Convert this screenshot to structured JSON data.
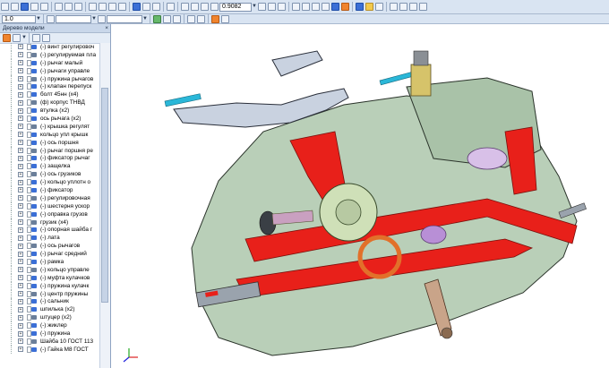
{
  "toolbar": {
    "zoom_value": "0.9082",
    "step_value": "1.0"
  },
  "panel": {
    "title": "Дерево модели",
    "close": "×"
  },
  "tree": [
    "(-) винт регулировоч",
    "(-) регулируемая пла",
    "(-) рычаг малый",
    "(-) рычаги управле",
    "(-) пружина рычагов",
    "(-) клапан перепуск",
    "болт 45нн (x4)",
    "(ф) корпус ТНВД",
    "втулка (x2)",
    "ось рычага (x2)",
    "(-) крышка регулят",
    "кольцо упл крышк",
    "(-) ось поршня",
    "(-) рычаг поршня ре",
    "(-) фиксатор рычаг",
    "(-) защелка",
    "(-) ось грузиков",
    "(-) кольцо уплотн о",
    "(-) фиксатор",
    "(-) регулировочная",
    "(-) шестерня ускор",
    "(-) оправка грузов",
    "грузик (x4)",
    "(-) опорная шайба г",
    "(-) лата",
    "(-) ось рычагов",
    "(-) рычаг средний",
    "(-) рамка",
    "(-) кольцо управле",
    "(-) муфта кулачков",
    "(-) пружина кулачк",
    "(-) центр пружины",
    "(-) сальник",
    "шпилька (x2)",
    "штуцер (x2)",
    "(-) жиклер",
    "(-) пружина",
    "Шайба 10 ГОСТ 113",
    "(-) Гайка М8 ГОСТ"
  ],
  "colors": {
    "body": "#b9cfb8",
    "cut": "#e8201a",
    "metal": "#9aa3ad",
    "accent_cyan": "#2ab7d8",
    "accent_yellow": "#d6c36a",
    "accent_purple": "#b88fd6"
  }
}
